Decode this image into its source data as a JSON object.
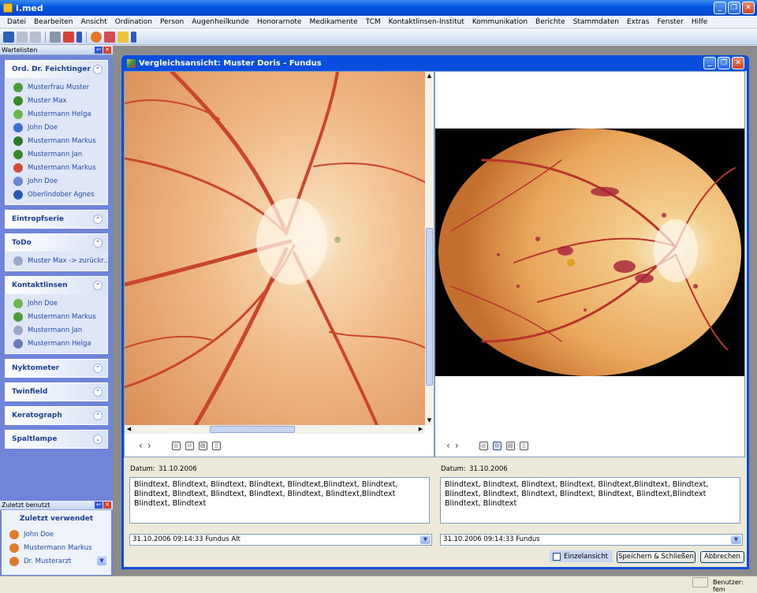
{
  "app": {
    "title": "i.med"
  },
  "menu": [
    "Datei",
    "Bearbeiten",
    "Ansicht",
    "Ordination",
    "Person",
    "Augenheilkunde",
    "Honorarnote",
    "Medikamente",
    "TCM",
    "Kontaktlinsen-Institut",
    "Kommunikation",
    "Berichte",
    "Stammdaten",
    "Extras",
    "Fenster",
    "Hilfe"
  ],
  "sidebar": {
    "pane_title": "Wartelisten",
    "groups": [
      {
        "title": "Ord. Dr. Feichtinger",
        "items": [
          "Musterfrau Muster",
          "Muster Max",
          "Mustermann Helga",
          "John Doe",
          "Mustermann Markus",
          "Mustermann Jan",
          "Mustermann Markus",
          "John Doe",
          "Oberlindober Agnes"
        ],
        "icons": [
          "#4a9a3a",
          "#3a8a2a",
          "#6ab84a",
          "#3a6fd0",
          "#2a7a2a",
          "#3a8a2a",
          "#d04a3a",
          "#6a8ad0",
          "#2a5ab0"
        ]
      },
      {
        "title": "Eintropfserie",
        "items": [],
        "icons": []
      },
      {
        "title": "ToDo",
        "items": [
          "Muster Max   -> zurückr.."
        ],
        "icons": [
          "#9aa6c8"
        ]
      },
      {
        "title": "Kontaktlinsen",
        "items": [
          "John Doe",
          "Mustermann Markus",
          "Mustermann Jan",
          "Mustermann Helga"
        ],
        "icons": [
          "#6ab84a",
          "#4a9a3a",
          "#9aa6c8",
          "#6a7ab8"
        ]
      },
      {
        "title": "Nyktometer",
        "items": [],
        "icons": []
      },
      {
        "title": "Twinfield",
        "items": [],
        "icons": []
      },
      {
        "title": "Keratograph",
        "items": [],
        "icons": []
      },
      {
        "title": "Spaltlampe",
        "items": [],
        "icons": []
      }
    ]
  },
  "recent": {
    "pane_title": "Zuletzt benutzt",
    "heading": "Zuletzt verwendet",
    "items": [
      "John Doe",
      "Mustermann Markus",
      "Dr. Musterarzt"
    ]
  },
  "compare": {
    "title": "Vergleichsansicht: Muster Doris - Fundus",
    "left": {
      "date_label": "Datum:",
      "date": "31.10.2006",
      "text": "Blindtext, Blindtext, Blindtext, Blindtext, Blindtext,Blindtext, Blindtext, Blindtext, Blindtext, Blindtext, Blindtext, Blindtext, Blindtext,Blindtext Blindtext, Blindtext",
      "selection": "31.10.2006 09:14:33 Fundus Alt"
    },
    "right": {
      "date_label": "Datum:",
      "date": "31.10.2006",
      "text": "Blindtext, Blindtext, Blindtext, Blindtext, Blindtext,Blindtext, Blindtext, Blindtext, Blindtext, Blindtext, Blindtext, Blindtext, Blindtext,Blindtext Blindtext, Blindtext",
      "selection": "31.10.2006 09:14:33 Fundus"
    },
    "single_view_label": "Einzelansicht",
    "save_label": "Speichern & Schließen",
    "cancel_label": "Abbrechen"
  },
  "status": {
    "user": "Benutzer: fem"
  }
}
